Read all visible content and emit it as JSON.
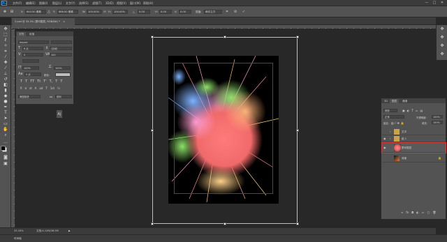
{
  "app": {
    "logo": "Ps"
  },
  "menu": [
    "文件(F)",
    "编辑(E)",
    "图像(I)",
    "图层(L)",
    "文字(Y)",
    "选择(S)",
    "滤镜(T)",
    "3D(D)",
    "视图(V)",
    "窗口(W)",
    "帮助(H)"
  ],
  "window_controls": {
    "minimize": "—",
    "maximize": "□",
    "close": "✕"
  },
  "options_bar": {
    "x_label": "X:",
    "x_value": "644.50 像素",
    "y_label": "Y:",
    "y_value": "866.00 像素",
    "w_label": "W:",
    "w_value": "100.00%",
    "h_label": "H:",
    "h_value": "100.00%",
    "angle_label": "△",
    "angle_value": "0.00",
    "hskew_label": "H:",
    "hskew_value": "0.00",
    "vskew_label": "V:",
    "vskew_value": "0.00",
    "interp_label": "插值:",
    "interp_value": "两次立方",
    "cancel_symbol": "⊘",
    "commit_symbol": "✓"
  },
  "document": {
    "tab_label": "2.psd @ 33.3% (蒙印图层, RGB/8#) *",
    "close_symbol": "×"
  },
  "character_panel": {
    "tabs": [
      "字符",
      "段落"
    ],
    "font_family": "Impact",
    "font_style": "",
    "size": "8 点",
    "leading": "(自动)",
    "kerning": "0",
    "tracking": "100",
    "vscale": "100%",
    "hscale": "100%",
    "baseline": "0 点",
    "color_label": "颜色:",
    "language": "美国英语",
    "aa_label": "aa",
    "aa_value": "锐利",
    "styles": [
      "T",
      "T",
      "TT",
      "Tt",
      "T'",
      "T,",
      "T",
      "T"
    ],
    "ot_styles": [
      "fi",
      "ơ",
      "st",
      "A",
      "ad",
      "T",
      "1st",
      "½"
    ]
  },
  "layers_panel": {
    "tabs": [
      "3D",
      "图层",
      "通道"
    ],
    "filter_label": "类型",
    "blend_mode": "正常",
    "opacity_label": "不透明度:",
    "opacity_value": "100%",
    "lock_label": "锁定:",
    "fill_label": "填充:",
    "fill_value": "100%",
    "layers": [
      {
        "name": "文字",
        "kind": "group",
        "visible": false
      },
      {
        "name": "组 1",
        "kind": "group",
        "visible": true
      },
      {
        "name": "蒙印图层",
        "kind": "pixel",
        "visible": true,
        "selected": true
      },
      {
        "name": "背景",
        "kind": "pixel",
        "visible": false,
        "locked": true
      }
    ],
    "footer_icons": [
      "∞",
      "fx",
      "◘",
      "◐",
      "▭",
      "▢",
      "🗑"
    ]
  },
  "status": {
    "zoom": "33.33%",
    "doc_info": "文档:4.12M/26.5M",
    "arrow": "▶"
  },
  "timeline": {
    "label": "时间轴"
  },
  "colors": {
    "selected_layer_outline": "#d43a3a",
    "accent": "#2fa3f7"
  }
}
